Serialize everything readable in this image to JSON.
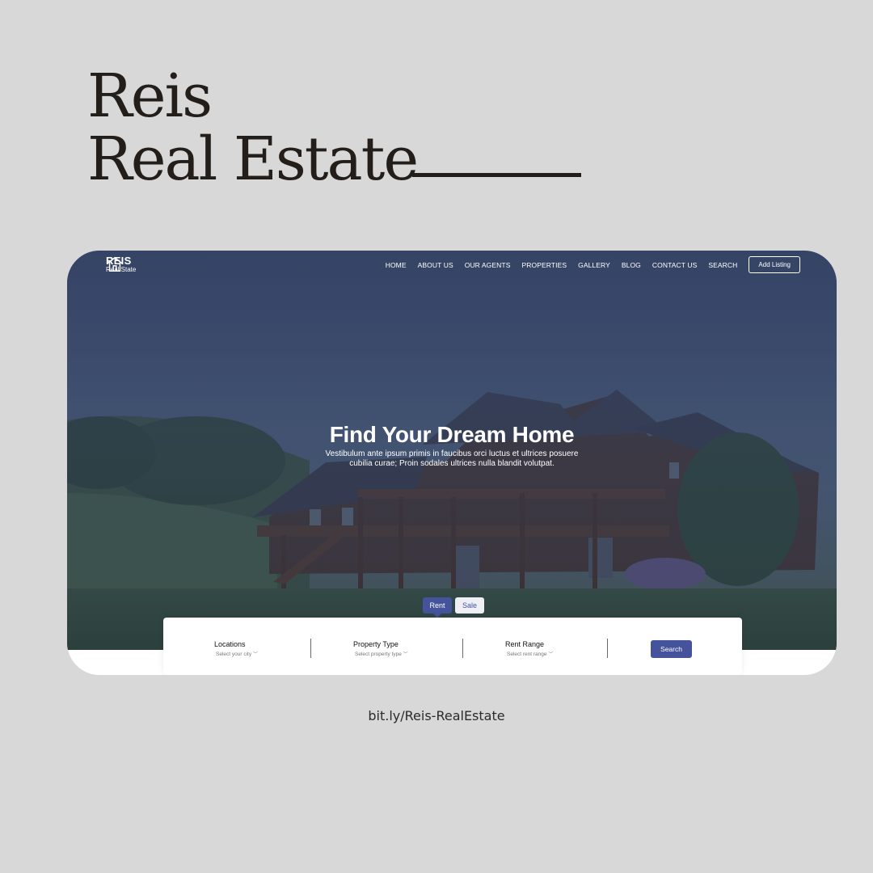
{
  "poster": {
    "title_line1": "Reis",
    "title_line2": "Real Estate",
    "url": "bit.ly/Reis-RealEstate"
  },
  "site": {
    "logo": {
      "name": "REIS",
      "sub": "Real State",
      "icon": "house-outline-icon"
    },
    "nav": {
      "items": [
        "HOME",
        "ABOUT US",
        "OUR AGENTS",
        "PROPERTIES",
        "GALLERY",
        "BLOG",
        "CONTACT US",
        "SEARCH"
      ],
      "cta": "Add Listing"
    },
    "hero": {
      "title": "Find Your Dream Home",
      "subtitle": "Vestibulum ante ipsum primis in faucibus orci luctus et ultrices posuere cubilia curae; Proin sodales ultrices nulla blandit volutpat."
    },
    "tabs": {
      "rent": "Rent",
      "sale": "Sale",
      "active": "Rent"
    },
    "search": {
      "locations": {
        "label": "Locations",
        "placeholder": "Select your city"
      },
      "property_type": {
        "label": "Property Type",
        "placeholder": "Select property type"
      },
      "rent_range": {
        "label": "Rent Range",
        "placeholder": "Select rent range"
      },
      "button": "Search"
    }
  },
  "colors": {
    "background": "#d8d8d8",
    "title_text": "#231e1a",
    "accent": "#44539b",
    "overlay": "#303e60"
  }
}
